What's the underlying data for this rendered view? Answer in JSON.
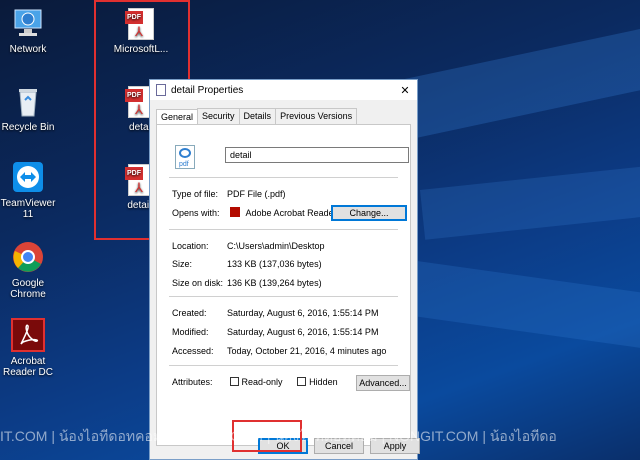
{
  "desktop": {
    "icons": [
      {
        "label": "Network",
        "icon": "network-icon"
      },
      {
        "label": "Recycle Bin",
        "icon": "recycle-bin-icon"
      },
      {
        "label": "TeamViewer 11",
        "icon": "teamviewer-icon"
      },
      {
        "label": "Google Chrome",
        "icon": "chrome-icon"
      },
      {
        "label": "Acrobat Reader DC",
        "icon": "acrobat-icon"
      }
    ],
    "pdf_files": [
      {
        "label": "MicrosoftL...",
        "tag": "PDF"
      },
      {
        "label": "detail",
        "tag": "PDF"
      },
      {
        "label": "detail-",
        "tag": "PDF"
      }
    ]
  },
  "dialog": {
    "title": "detail Properties",
    "close": "✕",
    "tabs": [
      "General",
      "Security",
      "Details",
      "Previous Versions"
    ],
    "active_tab": "General",
    "file_icon_caption": "pdf",
    "filename": "detail",
    "type_label": "Type of file:",
    "type_value": "PDF File (.pdf)",
    "opens_label": "Opens with:",
    "opens_value": "Adobe Acrobat Reader",
    "change_button": "Change...",
    "location_label": "Location:",
    "location_value": "C:\\Users\\admin\\Desktop",
    "size_label": "Size:",
    "size_value": "133 KB (137,036 bytes)",
    "disk_label": "Size on disk:",
    "disk_value": "136 KB (139,264 bytes)",
    "created_label": "Created:",
    "created_value": "Saturday, August 6, 2016, 1:55:14 PM",
    "modified_label": "Modified:",
    "modified_value": "Saturday, August 6, 2016, 1:55:14 PM",
    "accessed_label": "Accessed:",
    "accessed_value": "Today, October 21, 2016, 4 minutes ago",
    "attributes_label": "Attributes:",
    "readonly_label": "Read-only",
    "hidden_label": "Hidden",
    "advanced_button": "Advanced...",
    "ok_button": "OK",
    "cancel_button": "Cancel",
    "apply_button": "Apply"
  },
  "watermark": "IT.COM | น้องไอทีดอทคอม | NONGIT.COM | น้องไอทีดอทคอม | NONGIT.COM | น้องไอทีดอ"
}
